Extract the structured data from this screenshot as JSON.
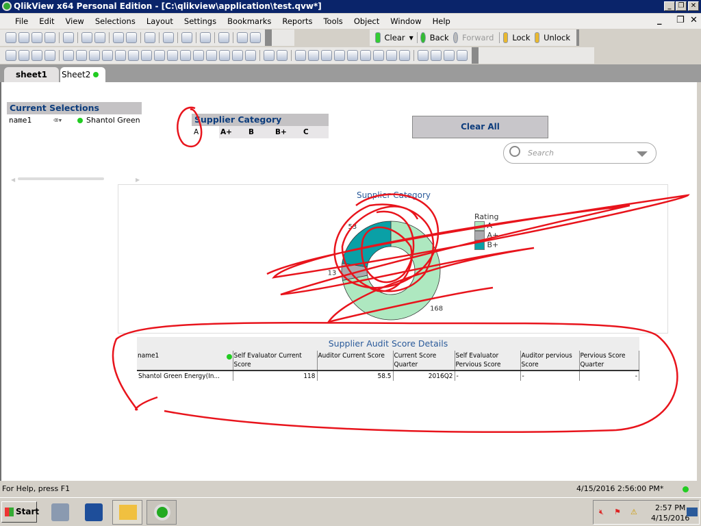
{
  "window": {
    "title": "QlikView x64 Personal Edition - [C:\\qlikview\\application\\test.qvw*]"
  },
  "menu": [
    "File",
    "Edit",
    "View",
    "Selections",
    "Layout",
    "Settings",
    "Bookmarks",
    "Reports",
    "Tools",
    "Object",
    "Window",
    "Help"
  ],
  "navbar": {
    "clear": "Clear",
    "back": "Back",
    "forward": "Forward",
    "lock": "Lock",
    "unlock": "Unlock"
  },
  "tabs": [
    {
      "label": "sheet1",
      "active": true
    },
    {
      "label": "Sheet2",
      "active": false
    }
  ],
  "current_selections": {
    "title": "Current Selections",
    "field": "name1",
    "value": "Shantol Green"
  },
  "listbox": {
    "title": "Supplier Category",
    "items": [
      "A",
      "A+",
      "B",
      "B+",
      "C"
    ]
  },
  "clear_all": "Clear All",
  "search": {
    "placeholder": "Search"
  },
  "chart_data": {
    "type": "pie",
    "title": "Supplier Category",
    "donut": true,
    "legend_title": "Rating",
    "legend": [
      "A",
      "A+",
      "B+"
    ],
    "categories": [
      "A",
      "A+",
      "B+"
    ],
    "values": [
      168,
      13,
      53
    ],
    "colors": [
      "#aee8c0",
      "#aaaaae",
      "#0aa0a6"
    ],
    "labels": [
      "168",
      "13",
      "53"
    ]
  },
  "table": {
    "title": "Supplier Audit Score Details",
    "columns": [
      "name1",
      "Self Evaluator Current Score",
      "Auditor Current Score",
      "Current Score Quarter",
      "Self Evaluator Pervious Score",
      "Auditor pervious Score",
      "Pervious Score Quarter"
    ],
    "rows": [
      [
        "Shantol Green Energy(In...",
        "118",
        "58.5",
        "2016Q2",
        "-",
        "-",
        "-"
      ]
    ]
  },
  "status": {
    "help": "For Help, press F1",
    "timestamp": "4/15/2016 2:56:00 PM*"
  },
  "taskbar": {
    "start": "Start",
    "time": "2:57 PM",
    "date": "4/15/2016"
  },
  "annotation_color": "#e8141c"
}
